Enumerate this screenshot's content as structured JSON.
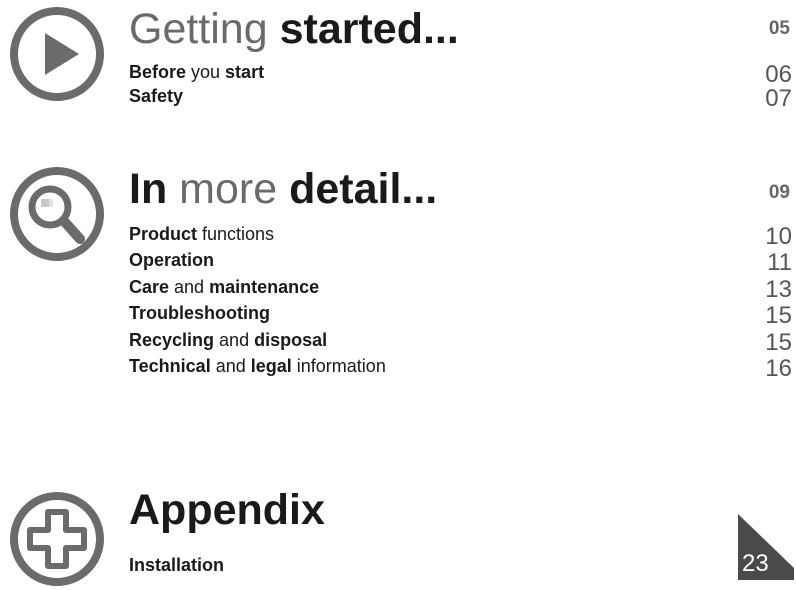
{
  "sections": [
    {
      "icon": "play-icon",
      "title": {
        "plain": "Getting ",
        "bold": "started..."
      },
      "page": "05",
      "entries": [
        {
          "parts": [
            {
              "t": "Before",
              "b": true
            },
            {
              "t": " you ",
              "b": false
            },
            {
              "t": "start",
              "b": true
            }
          ],
          "page": "06"
        },
        {
          "parts": [
            {
              "t": "Safety",
              "b": true
            }
          ],
          "page": "07"
        }
      ]
    },
    {
      "icon": "magnifier-icon",
      "title": {
        "bold1": "In",
        "plain": " more ",
        "bold2": "detail..."
      },
      "page": "09",
      "entries": [
        {
          "parts": [
            {
              "t": "Product",
              "b": true
            },
            {
              "t": " functions",
              "b": false
            }
          ],
          "page": "10"
        },
        {
          "parts": [
            {
              "t": "Operation",
              "b": true
            }
          ],
          "page": "11"
        },
        {
          "parts": [
            {
              "t": "Care",
              "b": true
            },
            {
              "t": " and ",
              "b": false
            },
            {
              "t": "maintenance",
              "b": true
            }
          ],
          "page": "13"
        },
        {
          "parts": [
            {
              "t": "Troubleshooting",
              "b": true
            }
          ],
          "page": "15"
        },
        {
          "parts": [
            {
              "t": "Recycling",
              "b": true
            },
            {
              "t": " and ",
              "b": false
            },
            {
              "t": "disposal",
              "b": true
            }
          ],
          "page": "15"
        },
        {
          "parts": [
            {
              "t": "Technical",
              "b": true
            },
            {
              "t": " and ",
              "b": false
            },
            {
              "t": "legal",
              "b": true
            },
            {
              "t": " information",
              "b": false
            }
          ],
          "page": "16"
        }
      ]
    },
    {
      "icon": "plus-icon",
      "title": {
        "bold": "Appendix"
      },
      "entries": [
        {
          "parts": [
            {
              "t": "Installation",
              "b": true
            }
          ]
        }
      ]
    }
  ],
  "page_number": "23",
  "colors": {
    "icon_gray": "#6b6b6b",
    "tab_gray": "#4a4a4a",
    "text": "#1a1a1a"
  }
}
